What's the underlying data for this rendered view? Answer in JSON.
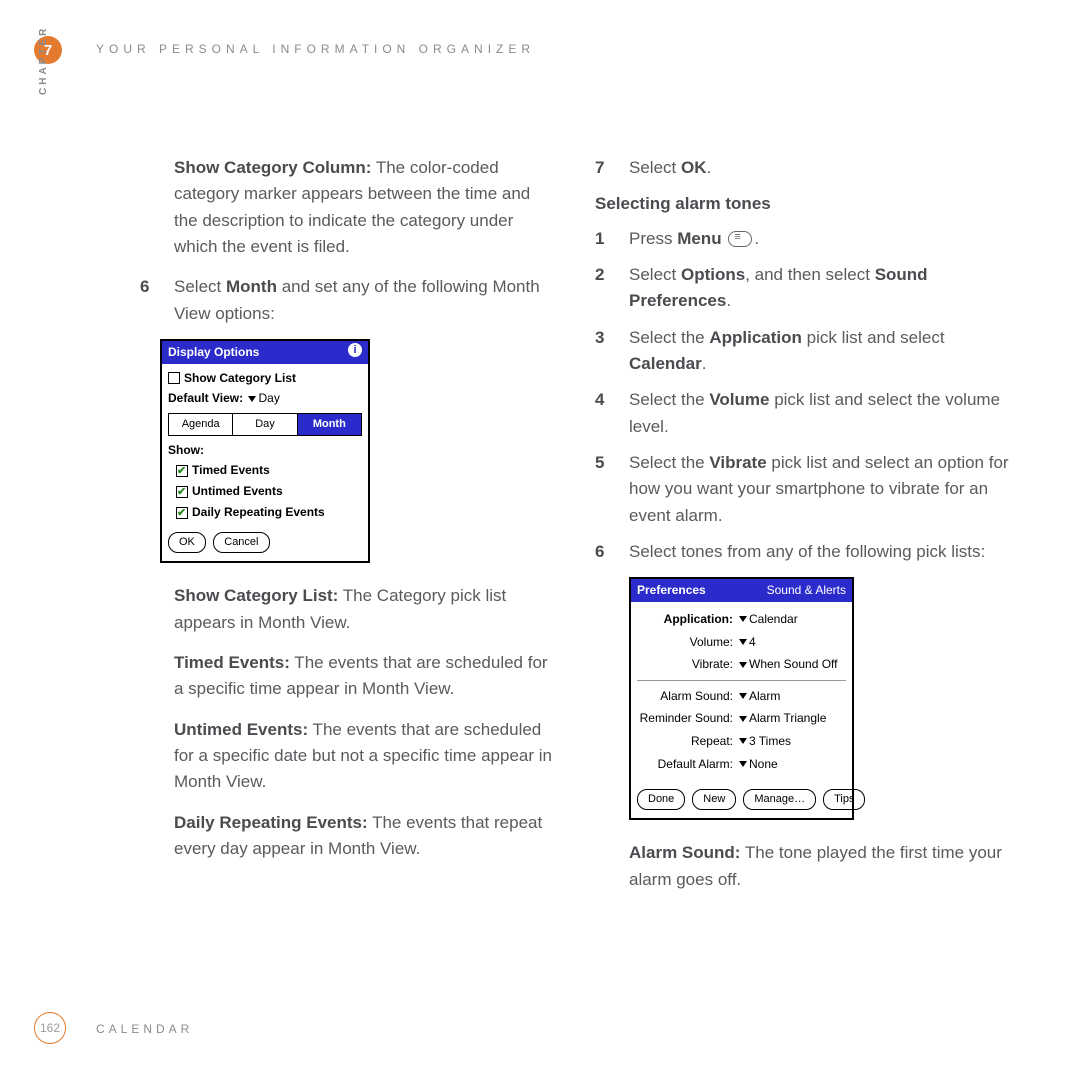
{
  "header": {
    "chapter_num": "7",
    "title": "YOUR PERSONAL INFORMATION ORGANIZER",
    "side_label": "CHAPTER"
  },
  "left": {
    "show_cat_col_label": "Show Category Column:",
    "show_cat_col_text": " The color-coded category marker appears between the time and the description to indicate the category under which the event is filed.",
    "step6_num": "6",
    "step6_a": "Select ",
    "step6_bold": "Month",
    "step6_b": " and set any of the following Month View options:",
    "show_cat_list_label": "Show Category List:",
    "show_cat_list_text": " The Category pick list appears in Month View.",
    "timed_label": "Timed Events:",
    "timed_text": " The events that are scheduled for a specific time appear in Month View.",
    "untimed_label": "Untimed Events:",
    "untimed_text": " The events that are scheduled for a specific date but not a specific time appear in Month View.",
    "daily_label": "Daily Repeating Events:",
    "daily_text": " The events that repeat every day appear in Month View."
  },
  "dialog1": {
    "title": "Display Options",
    "show_cat_list": "Show Category List",
    "default_view_label": "Default View:",
    "default_view_value": "Day",
    "tabs": {
      "agenda": "Agenda",
      "day": "Day",
      "month": "Month"
    },
    "show_label": "Show:",
    "opt_timed": "Timed Events",
    "opt_untimed": "Untimed Events",
    "opt_daily": "Daily Repeating Events",
    "ok": "OK",
    "cancel": "Cancel"
  },
  "right": {
    "step7_num": "7",
    "step7_a": "Select ",
    "step7_bold": "OK",
    "step7_b": ".",
    "heading": "Selecting alarm tones",
    "s1_num": "1",
    "s1_a": "Press ",
    "s1_bold": "Menu",
    "s1_b": " .",
    "s2_num": "2",
    "s2_a": "Select ",
    "s2_bold1": "Options",
    "s2_mid": ", and then select ",
    "s2_bold2": "Sound Preferences",
    "s2_end": ".",
    "s3_num": "3",
    "s3_a": "Select the ",
    "s3_bold1": "Application",
    "s3_mid": " pick list and select ",
    "s3_bold2": "Calendar",
    "s3_end": ".",
    "s4_num": "4",
    "s4_a": "Select the ",
    "s4_bold": "Volume",
    "s4_b": " pick list and select the volume level.",
    "s5_num": "5",
    "s5_a": "Select the ",
    "s5_bold": "Vibrate",
    "s5_b": " pick list and select an option for how you want your smartphone to vibrate for an event alarm.",
    "s6_num": "6",
    "s6_text": "Select tones from any of the following pick lists:",
    "alarm_label": "Alarm Sound:",
    "alarm_text": " The tone played the first time your alarm goes off."
  },
  "dialog2": {
    "title": "Preferences",
    "category": "Sound & Alerts",
    "rows": {
      "application_l": "Application:",
      "application_v": "Calendar",
      "volume_l": "Volume:",
      "volume_v": "4",
      "vibrate_l": "Vibrate:",
      "vibrate_v": "When Sound Off",
      "alarm_sound_l": "Alarm Sound:",
      "alarm_sound_v": "Alarm",
      "reminder_l": "Reminder Sound:",
      "reminder_v": "Alarm Triangle",
      "repeat_l": "Repeat:",
      "repeat_v": "3 Times",
      "default_alarm_l": "Default Alarm:",
      "default_alarm_v": "None"
    },
    "buttons": {
      "done": "Done",
      "new": "New",
      "manage": "Manage…",
      "tips": "Tips"
    }
  },
  "footer": {
    "page": "162",
    "title": "CALENDAR"
  }
}
